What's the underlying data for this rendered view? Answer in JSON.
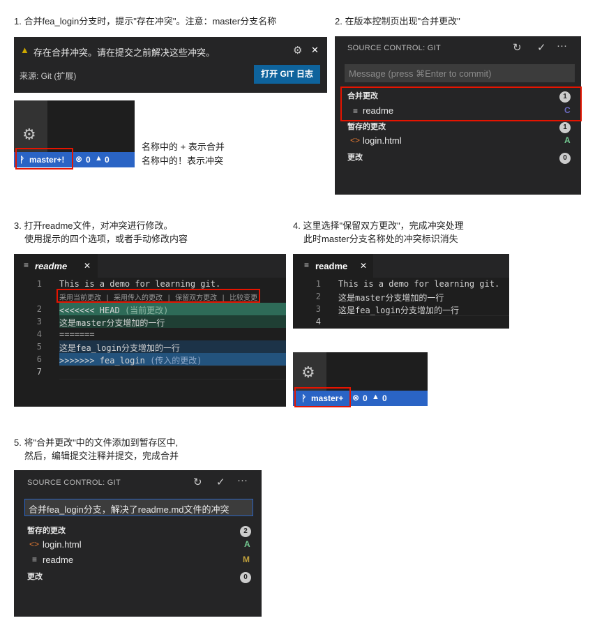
{
  "captions": {
    "c1": "1. 合并fea_login分支时，提示\"存在冲突\"。注意：master分支名称",
    "c2": "2. 在版本控制页出现\"合并更改\"",
    "c3a": "3. 打开readme文件，对冲突进行修改。",
    "c3b": "使用提示的四个选项，或者手动修改内容",
    "c4a": "4. 这里选择\"保留双方更改\"，完成冲突处理",
    "c4b": "此时master分支名称处的冲突标识消失",
    "c5a": "5. 将\"合并更改\"中的文件添加到暂存区中,",
    "c5b": "然后，编辑提交注释并提交，完成合并",
    "note1": "名称中的 + 表示合并",
    "note2": "名称中的！表示冲突"
  },
  "notification": {
    "message": "存在合并冲突。请在提交之前解决这些冲突。",
    "source": "来源: Git (扩展)",
    "button": "打开 GIT 日志"
  },
  "status1": {
    "branch": "master+!",
    "errors": "0",
    "warnings": "0"
  },
  "status2": {
    "branch": "master+",
    "errors": "0",
    "warnings": "0"
  },
  "scm1": {
    "title": "SOURCE CONTROL: GIT",
    "placeholder": "Message (press ⌘Enter to commit)",
    "merge_section": "合并更改",
    "merge_count": "1",
    "merge_file": "readme",
    "merge_file_status": "C",
    "staged_section": "暂存的更改",
    "staged_count": "1",
    "staged_file": "login.html",
    "staged_file_status": "A",
    "changes_section": "更改",
    "changes_count": "0"
  },
  "editor1": {
    "tab": "readme",
    "codelens": "采用当前更改 | 采用传入的更改 | 保留双方更改 | 比较变更",
    "lines": [
      {
        "n": "1",
        "text": "This is a demo for learning git."
      },
      {
        "n": "2",
        "text": "<<<<<<< HEAD",
        "hint": "(当前更改)"
      },
      {
        "n": "3",
        "text": "这是master分支增加的一行"
      },
      {
        "n": "4",
        "text": "======="
      },
      {
        "n": "5",
        "text": "这是fea_login分支增加的一行"
      },
      {
        "n": "6",
        "text": ">>>>>>> fea_login",
        "hint": "(传入的更改)"
      },
      {
        "n": "7",
        "text": ""
      }
    ]
  },
  "editor2": {
    "tab": "readme",
    "lines": [
      {
        "n": "1",
        "text": "This is a demo for learning git."
      },
      {
        "n": "2",
        "text": "这是master分支增加的一行"
      },
      {
        "n": "3",
        "text": "这是fea_login分支增加的一行"
      },
      {
        "n": "4",
        "text": ""
      }
    ]
  },
  "scm2": {
    "title": "SOURCE CONTROL: GIT",
    "message": "合并fea_login分支，解决了readme.md文件的冲突",
    "staged_section": "暂存的更改",
    "staged_count": "2",
    "file1": "login.html",
    "file1_status": "A",
    "file2": "readme",
    "file2_status": "M",
    "changes_section": "更改",
    "changes_count": "0"
  }
}
